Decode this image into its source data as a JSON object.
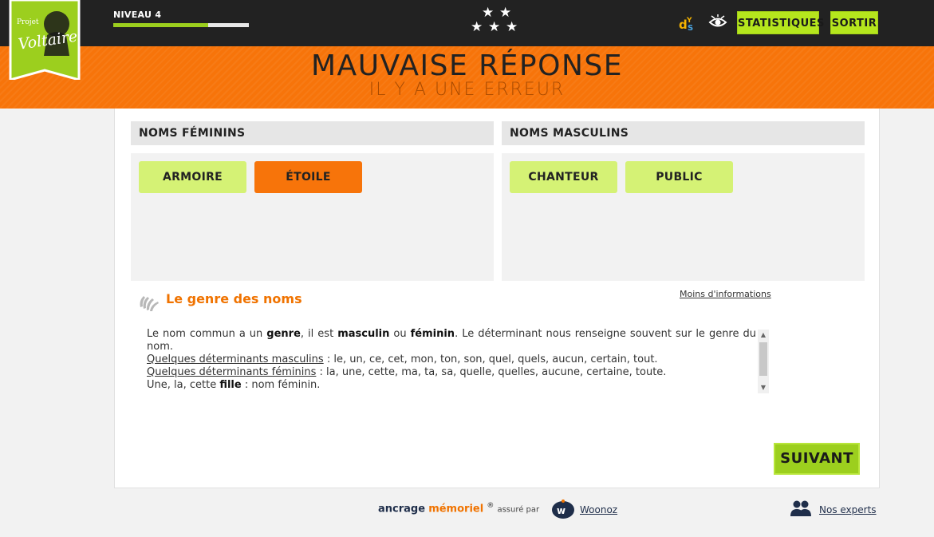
{
  "header": {
    "logo_text_top": "Projet",
    "logo_text_main": "Voltaire",
    "level_label": "NIVEAU 4",
    "level_progress": 0.7,
    "stars": 5,
    "stats_button": "STATISTIQUES",
    "exit_button": "SORTIR",
    "dys_icon": "dys-icon",
    "eye_icon": "eye-icon"
  },
  "banner": {
    "title": "MAUVAISE RÉPONSE",
    "subtitle": "IL Y A UNE ERREUR"
  },
  "columns": {
    "left": {
      "title": "NOMS FÉMININS",
      "words": [
        {
          "label": "ARMOIRE",
          "status": "correct"
        },
        {
          "label": "ÉTOILE",
          "status": "error"
        }
      ]
    },
    "right": {
      "title": "NOMS MASCULINS",
      "words": [
        {
          "label": "CHANTEUR",
          "status": "correct"
        },
        {
          "label": "PUBLIC",
          "status": "correct"
        }
      ]
    }
  },
  "info": {
    "title": "Le genre des noms",
    "less_info_link": "Moins d'informations",
    "line1_a": "Le nom commun a un ",
    "line1_b": "genre",
    "line1_c": ", il est ",
    "line1_d": "masculin",
    "line1_e": " ou ",
    "line1_f": "féminin",
    "line1_g": ". Le déterminant nous renseigne souvent sur le genre du nom.",
    "masc_label": "Quelques déterminants masculins",
    "masc_list": " : le, un, ce, cet, mon, ton, son, quel, quels, aucun, certain, tout.",
    "fem_label": "Quelques déterminants féminins",
    "fem_list": " : la, une, cette, ma, ta, sa, quelle, quelles, aucune, certaine, toute.",
    "example_a": "Une, la, cette ",
    "example_b": "fille",
    "example_c": " : nom féminin."
  },
  "next_button": "SUIVANT",
  "footer": {
    "brand_1": "ancrage",
    "brand_2": "mémoriel",
    "registered": "®",
    "assured_by": "assuré par",
    "woonoz": "Woonoz",
    "experts": "Nos experts"
  },
  "colors": {
    "accent_orange": "#f7740a",
    "accent_green": "#b5e61d",
    "word_correct": "#d5f275",
    "dark_bar": "#222222"
  }
}
